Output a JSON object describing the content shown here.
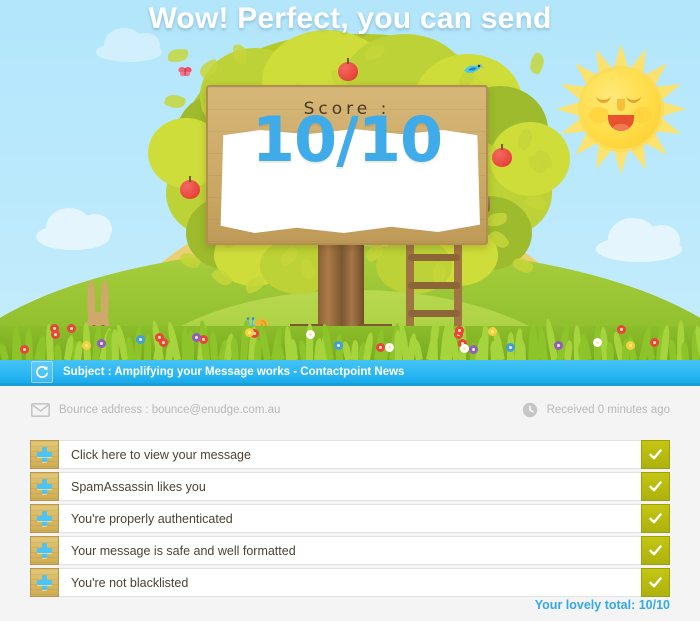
{
  "hero": {
    "headline": "Wow! Perfect, you can send",
    "sign_label": "Score :",
    "score_value": "10/10",
    "illustration": {
      "sun_icon": "smiling-sun-icon",
      "rainbow_icon": "rainbow-icon",
      "tree_icon": "tree-icon",
      "rabbit_icon": "rabbit-icon",
      "snail_icon": "snail-icon",
      "bird_icon": "bird-icon",
      "butterfly_icon": "butterfly-icon",
      "apple_icon": "apple-icon",
      "ladder_icon": "ladder-icon"
    }
  },
  "subject_bar": {
    "refresh_icon": "refresh-icon",
    "text": "Subject : Amplifying your Message works - Contactpoint News"
  },
  "meta": {
    "bounce_icon": "envelope-icon",
    "bounce_text": "Bounce address : bounce@enudge.com.au",
    "clock_icon": "clock-icon",
    "received_text": "Received 0 minutes ago"
  },
  "checklist": {
    "items": [
      {
        "icon": "plus-icon",
        "label": "Click here to view your message",
        "check_icon": "checkmark-icon"
      },
      {
        "icon": "plus-icon",
        "label": "SpamAssassin likes you",
        "check_icon": "checkmark-icon"
      },
      {
        "icon": "plus-icon",
        "label": "You're properly authenticated",
        "check_icon": "checkmark-icon"
      },
      {
        "icon": "plus-icon",
        "label": "Your message is safe and well formatted",
        "check_icon": "checkmark-icon"
      },
      {
        "icon": "plus-icon",
        "label": "You're not blacklisted",
        "check_icon": "checkmark-icon"
      }
    ]
  },
  "footer": {
    "total_text": "Your lovely total: 10/10"
  },
  "colors": {
    "sky": "#b3e6fb",
    "subject_bar": "#27b5f2",
    "accent_blue": "#35a8e8",
    "score_blue": "#3fabe8",
    "check_olive": "#b8bb10",
    "wood_tan": "#d9b961",
    "page_bg": "#f4f4f4",
    "meta_gray": "#b9b9b9",
    "row_text": "#4a4238"
  }
}
